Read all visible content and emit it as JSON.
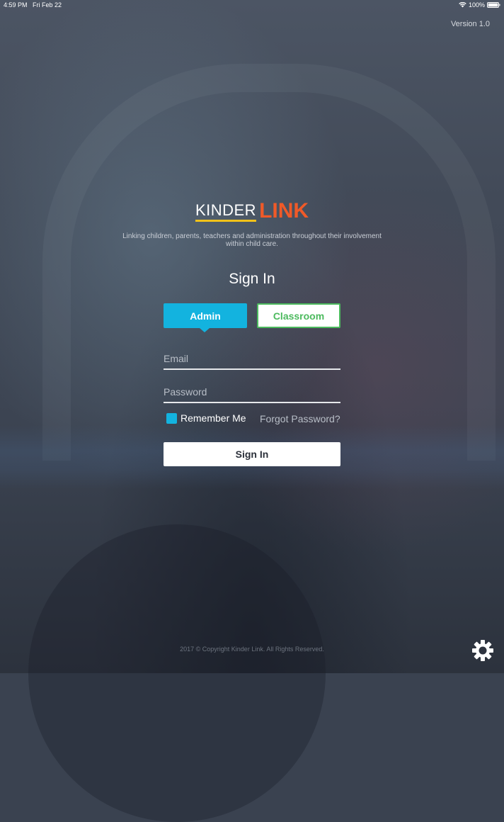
{
  "status_bar": {
    "time": "4:59 PM",
    "date": "Fri Feb 22",
    "battery": "100%",
    "icons": [
      "wifi-icon",
      "battery-icon"
    ]
  },
  "version": "Version 1.0",
  "logo": {
    "kinder": "KINDER",
    "link": "LINK",
    "colors": {
      "kinder": "#ffffff",
      "underline": "#f2c219",
      "link": "#f05a28"
    }
  },
  "tagline": "Linking children, parents, teachers and administration throughout their involvement within child care.",
  "signin_title": "Sign In",
  "roles": {
    "admin": "Admin",
    "classroom": "Classroom",
    "selected": "Admin",
    "colors": {
      "admin": "#13b3df",
      "classroom": "#4cba5e"
    }
  },
  "form": {
    "email_placeholder": "Email",
    "email_value": "",
    "password_placeholder": "Password",
    "password_value": "",
    "remember_label": "Remember Me",
    "remember_checked": true,
    "forgot_label": "Forgot Password?",
    "submit_label": "Sign In"
  },
  "footer": {
    "copyright": "2017 © Copyright Kinder Link. All Rights Reserved."
  },
  "settings": {
    "icon": "gear-icon"
  }
}
